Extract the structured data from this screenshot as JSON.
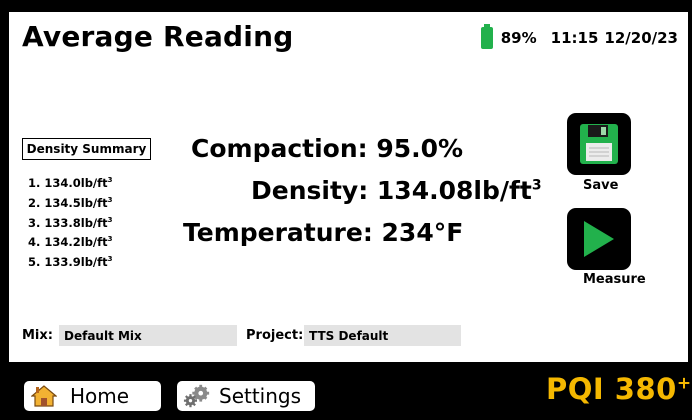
{
  "header": {
    "title": "Average Reading",
    "battery_percent": "89%",
    "time": "11:15",
    "date": "12/20/23",
    "battery_icon": "battery-icon",
    "battery_color": "#22b14c"
  },
  "summary": {
    "title": "Density Summary",
    "unit_base": "lb/ft",
    "unit_exp": "3",
    "items": [
      {
        "prefix": "1. 134.0"
      },
      {
        "prefix": "2. 134.5"
      },
      {
        "prefix": "3. 133.8"
      },
      {
        "prefix": "4. 134.2"
      },
      {
        "prefix": "5. 133.9"
      }
    ]
  },
  "readings": {
    "compaction": "Compaction: 95.0%",
    "density_prefix": "Density: 134.08lb/ft",
    "density_exp": "3",
    "temperature": "Temperature: 234°F"
  },
  "actions": {
    "save_label": "Save",
    "save_icon": "floppy-disk-icon",
    "measure_label": "Measure",
    "measure_icon": "play-icon",
    "accent_color": "#22b14c"
  },
  "fields": {
    "mix_label": "Mix:",
    "mix_value": "Default Mix",
    "project_label": "Project:",
    "project_value": "TTS Default"
  },
  "nav": {
    "home_label": "Home",
    "home_icon": "home-icon",
    "settings_label": "Settings",
    "settings_icon": "gears-icon"
  },
  "brand": {
    "name": "PQI 380",
    "sup": "+",
    "color": "#f5b800"
  }
}
